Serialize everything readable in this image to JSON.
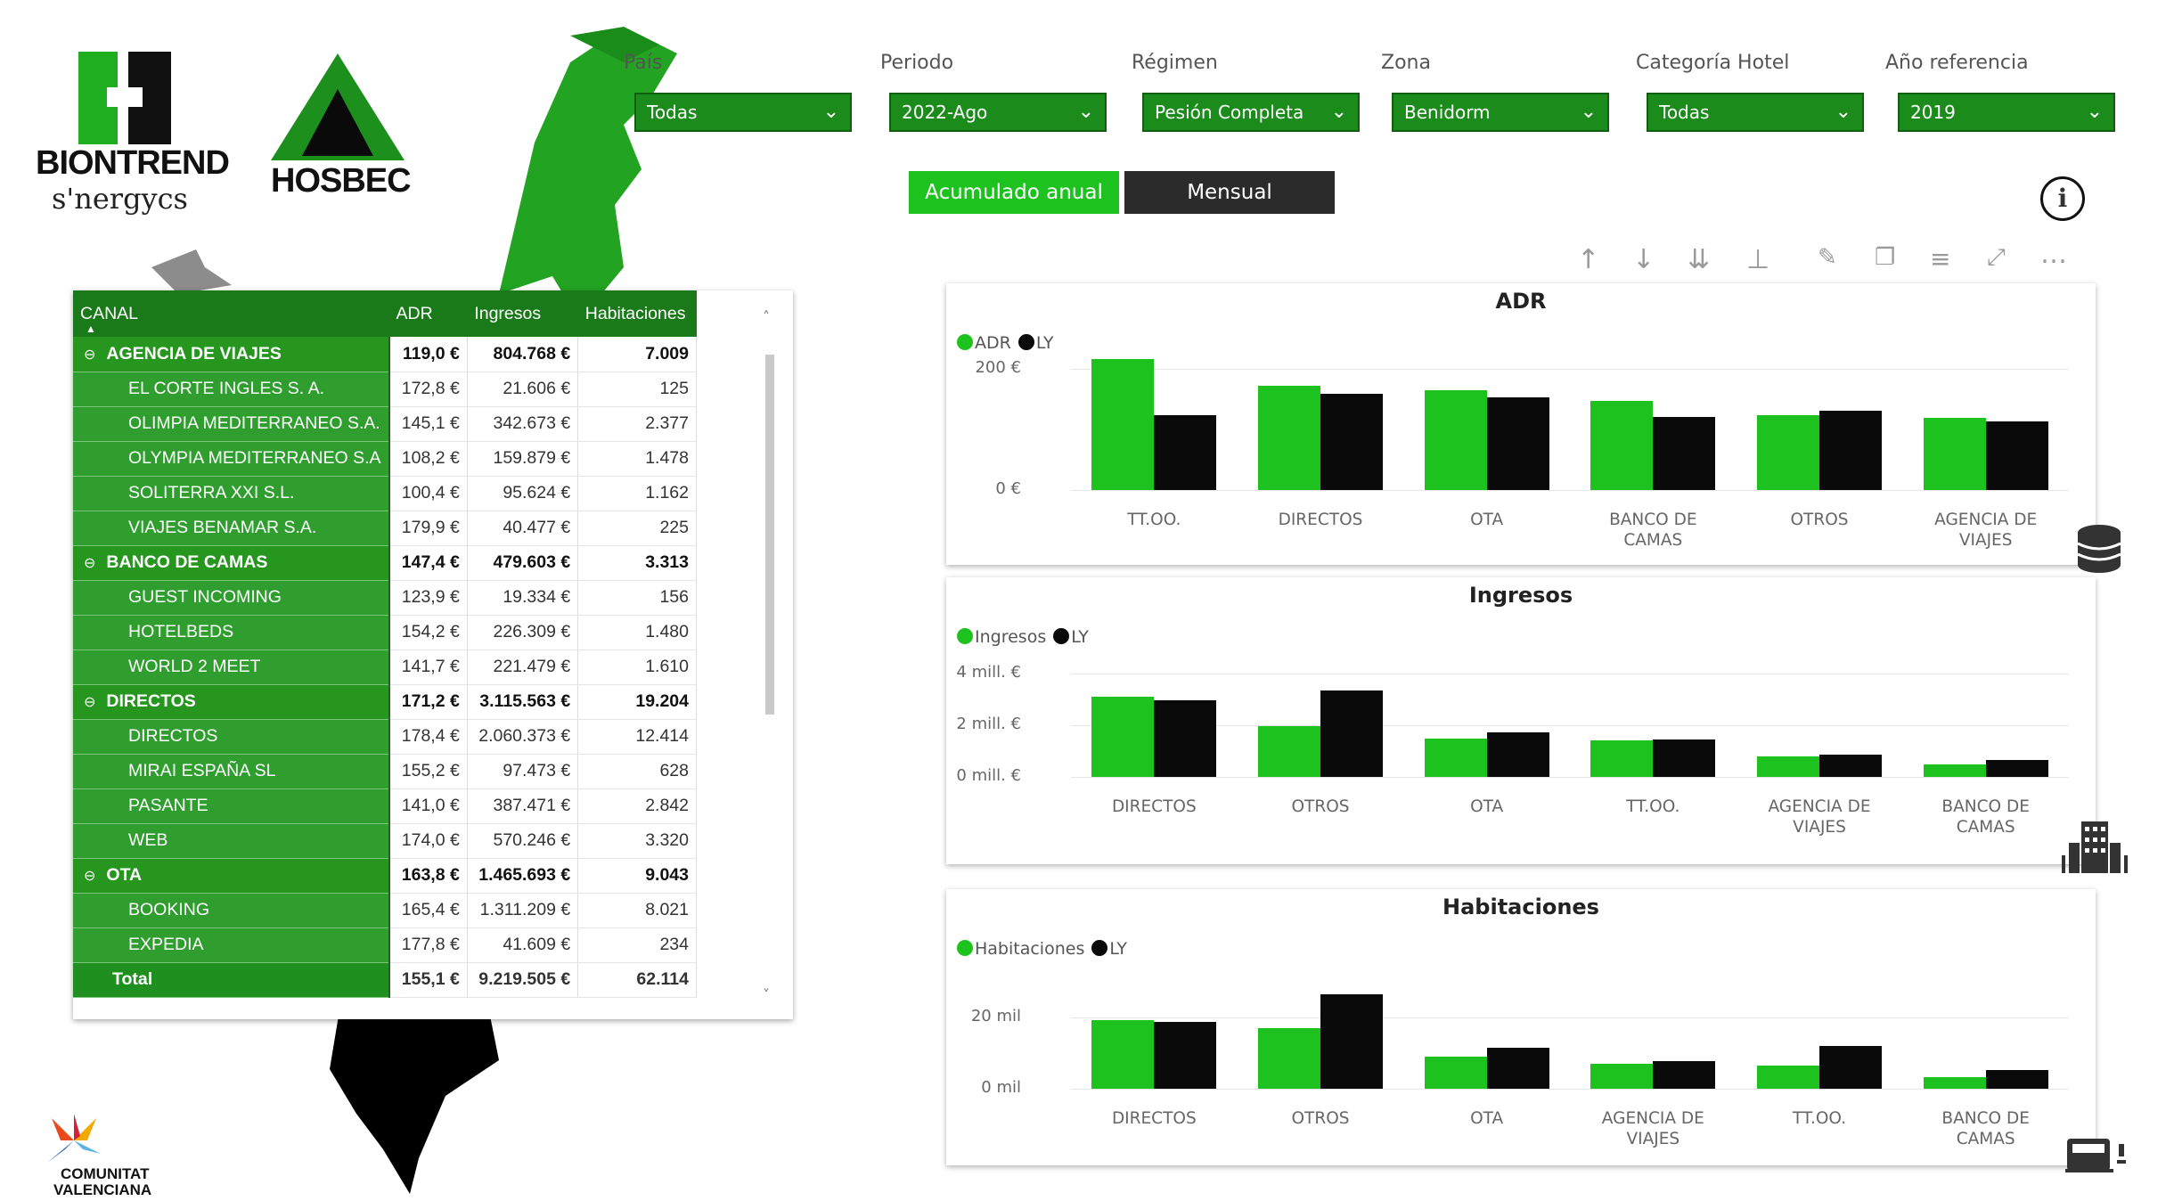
{
  "brand": {
    "logo1_line1": "BIONTREND",
    "logo1_line2": "s'nergycs",
    "logo2": "HOSBEC",
    "logo3_line1": "COMUNITAT",
    "logo3_line2": "VALENCIANA"
  },
  "filters": [
    {
      "label": "País",
      "value": "Todas"
    },
    {
      "label": "Periodo",
      "value": "2022-Ago"
    },
    {
      "label": "Régimen",
      "value": "Pesión Completa"
    },
    {
      "label": "Zona",
      "value": "Benidorm"
    },
    {
      "label": "Categoría Hotel",
      "value": "Todas"
    },
    {
      "label": "Año referencia",
      "value": "2019"
    }
  ],
  "toggle": {
    "active": "Acumulado anual",
    "inactive": "Mensual"
  },
  "colors": {
    "green": "#1ec21e",
    "black": "#0a0a0a",
    "dark_green": "#1a7a1a"
  },
  "icons": [
    "info-icon",
    "sort-asc-icon",
    "sort-desc-icon",
    "expand-all-icon",
    "hierarchy-icon",
    "pin-icon",
    "copy-icon",
    "filter-icon",
    "focus-icon",
    "more-icon",
    "database-icon",
    "building-icon",
    "bed-icon"
  ],
  "table": {
    "headers": [
      "CANAL",
      "ADR",
      "Ingresos",
      "Habitaciones"
    ],
    "rows": [
      {
        "type": "group",
        "name": "AGENCIA DE VIAJES",
        "adr": "119,0 €",
        "ingresos": "804.768 €",
        "hab": "7.009"
      },
      {
        "type": "item",
        "name": "EL CORTE INGLES S. A.",
        "adr": "172,8 €",
        "ingresos": "21.606 €",
        "hab": "125"
      },
      {
        "type": "item",
        "name": "OLIMPIA MEDITERRANEO S.A.",
        "adr": "145,1 €",
        "ingresos": "342.673 €",
        "hab": "2.377"
      },
      {
        "type": "item",
        "name": "OLYMPIA MEDITERRANEO S.A",
        "adr": "108,2 €",
        "ingresos": "159.879 €",
        "hab": "1.478"
      },
      {
        "type": "item",
        "name": "SOLITERRA XXI S.L.",
        "adr": "100,4 €",
        "ingresos": "95.624 €",
        "hab": "1.162"
      },
      {
        "type": "item",
        "name": "VIAJES BENAMAR S.A.",
        "adr": "179,9 €",
        "ingresos": "40.477 €",
        "hab": "225"
      },
      {
        "type": "group",
        "name": "BANCO DE CAMAS",
        "adr": "147,4 €",
        "ingresos": "479.603 €",
        "hab": "3.313"
      },
      {
        "type": "item",
        "name": "GUEST INCOMING",
        "adr": "123,9 €",
        "ingresos": "19.334 €",
        "hab": "156"
      },
      {
        "type": "item",
        "name": "HOTELBEDS",
        "adr": "154,2 €",
        "ingresos": "226.309 €",
        "hab": "1.480"
      },
      {
        "type": "item",
        "name": "WORLD 2 MEET",
        "adr": "141,7 €",
        "ingresos": "221.479 €",
        "hab": "1.610"
      },
      {
        "type": "group",
        "name": "DIRECTOS",
        "adr": "171,2 €",
        "ingresos": "3.115.563 €",
        "hab": "19.204"
      },
      {
        "type": "item",
        "name": "DIRECTOS",
        "adr": "178,4 €",
        "ingresos": "2.060.373 €",
        "hab": "12.414"
      },
      {
        "type": "item",
        "name": "MIRAI ESPAÑA SL",
        "adr": "155,2 €",
        "ingresos": "97.473 €",
        "hab": "628"
      },
      {
        "type": "item",
        "name": "PASANTE",
        "adr": "141,0 €",
        "ingresos": "387.471 €",
        "hab": "2.842"
      },
      {
        "type": "item",
        "name": "WEB",
        "adr": "174,0 €",
        "ingresos": "570.246 €",
        "hab": "3.320"
      },
      {
        "type": "group",
        "name": "OTA",
        "adr": "163,8 €",
        "ingresos": "1.465.693 €",
        "hab": "9.043"
      },
      {
        "type": "item",
        "name": "BOOKING",
        "adr": "165,4 €",
        "ingresos": "1.311.209 €",
        "hab": "8.021"
      },
      {
        "type": "item",
        "name": "EXPEDIA",
        "adr": "177,8 €",
        "ingresos": "41.609 €",
        "hab": "234"
      }
    ],
    "total": {
      "name": "Total",
      "adr": "155,1 €",
      "ingresos": "9.219.505 €",
      "hab": "62.114"
    },
    "group_toggle_symbol": "⊖"
  },
  "chart_data": [
    {
      "type": "bar",
      "title": "ADR",
      "categories": [
        "TT.OO.",
        "DIRECTOS",
        "OTA",
        "BANCO DE CAMAS",
        "OTROS",
        "AGENCIA DE VIAJES"
      ],
      "category_lines": [
        [
          "TT.OO."
        ],
        [
          "DIRECTOS"
        ],
        [
          "OTA"
        ],
        [
          "BANCO DE",
          "CAMAS"
        ],
        [
          "OTROS"
        ],
        [
          "AGENCIA DE",
          "VIAJES"
        ]
      ],
      "series": [
        {
          "name": "ADR",
          "color": "#1ec21e",
          "values": [
            216,
            171,
            164,
            147,
            123,
            119
          ]
        },
        {
          "name": "LY",
          "color": "#0a0a0a",
          "values": [
            123,
            158,
            152,
            121,
            130,
            113
          ]
        }
      ],
      "yticks": [
        {
          "value": 200,
          "label": "200 €"
        },
        {
          "value": 0,
          "label": "0 €"
        }
      ],
      "ylim": [
        0,
        220
      ],
      "legend": "top-left"
    },
    {
      "type": "bar",
      "title": "Ingresos",
      "categories": [
        "DIRECTOS",
        "OTROS",
        "OTA",
        "TT.OO.",
        "AGENCIA DE VIAJES",
        "BANCO DE CAMAS"
      ],
      "category_lines": [
        [
          "DIRECTOS"
        ],
        [
          "OTROS"
        ],
        [
          "OTA"
        ],
        [
          "TT.OO."
        ],
        [
          "AGENCIA DE",
          "VIAJES"
        ],
        [
          "BANCO DE",
          "CAMAS"
        ]
      ],
      "series": [
        {
          "name": "Ingresos",
          "color": "#1ec21e",
          "values": [
            3.1,
            1.95,
            1.47,
            1.4,
            0.8,
            0.48
          ]
        },
        {
          "name": "LY",
          "color": "#0a0a0a",
          "values": [
            2.95,
            3.35,
            1.72,
            1.45,
            0.85,
            0.65
          ]
        }
      ],
      "yticks": [
        {
          "value": 4,
          "label": "4 mill. €"
        },
        {
          "value": 2,
          "label": "2 mill. €"
        },
        {
          "value": 0,
          "label": "0 mill. €"
        }
      ],
      "ylim": [
        0,
        4
      ],
      "legend": "top-left"
    },
    {
      "type": "bar",
      "title": "Habitaciones",
      "categories": [
        "DIRECTOS",
        "OTROS",
        "OTA",
        "AGENCIA DE VIAJES",
        "TT.OO.",
        "BANCO DE CAMAS"
      ],
      "category_lines": [
        [
          "DIRECTOS"
        ],
        [
          "OTROS"
        ],
        [
          "OTA"
        ],
        [
          "AGENCIA DE",
          "VIAJES"
        ],
        [
          "TT.OO."
        ],
        [
          "BANCO DE",
          "CAMAS"
        ]
      ],
      "series": [
        {
          "name": "Habitaciones",
          "color": "#1ec21e",
          "values": [
            19.2,
            17.0,
            9.0,
            7.0,
            6.5,
            3.3
          ]
        },
        {
          "name": "LY",
          "color": "#0a0a0a",
          "values": [
            18.8,
            26.5,
            11.5,
            7.8,
            12.0,
            5.2
          ]
        }
      ],
      "yticks": [
        {
          "value": 20,
          "label": "20 mil"
        },
        {
          "value": 0,
          "label": "0 mil"
        }
      ],
      "ylim": [
        0,
        28
      ],
      "legend": "top-left"
    }
  ]
}
